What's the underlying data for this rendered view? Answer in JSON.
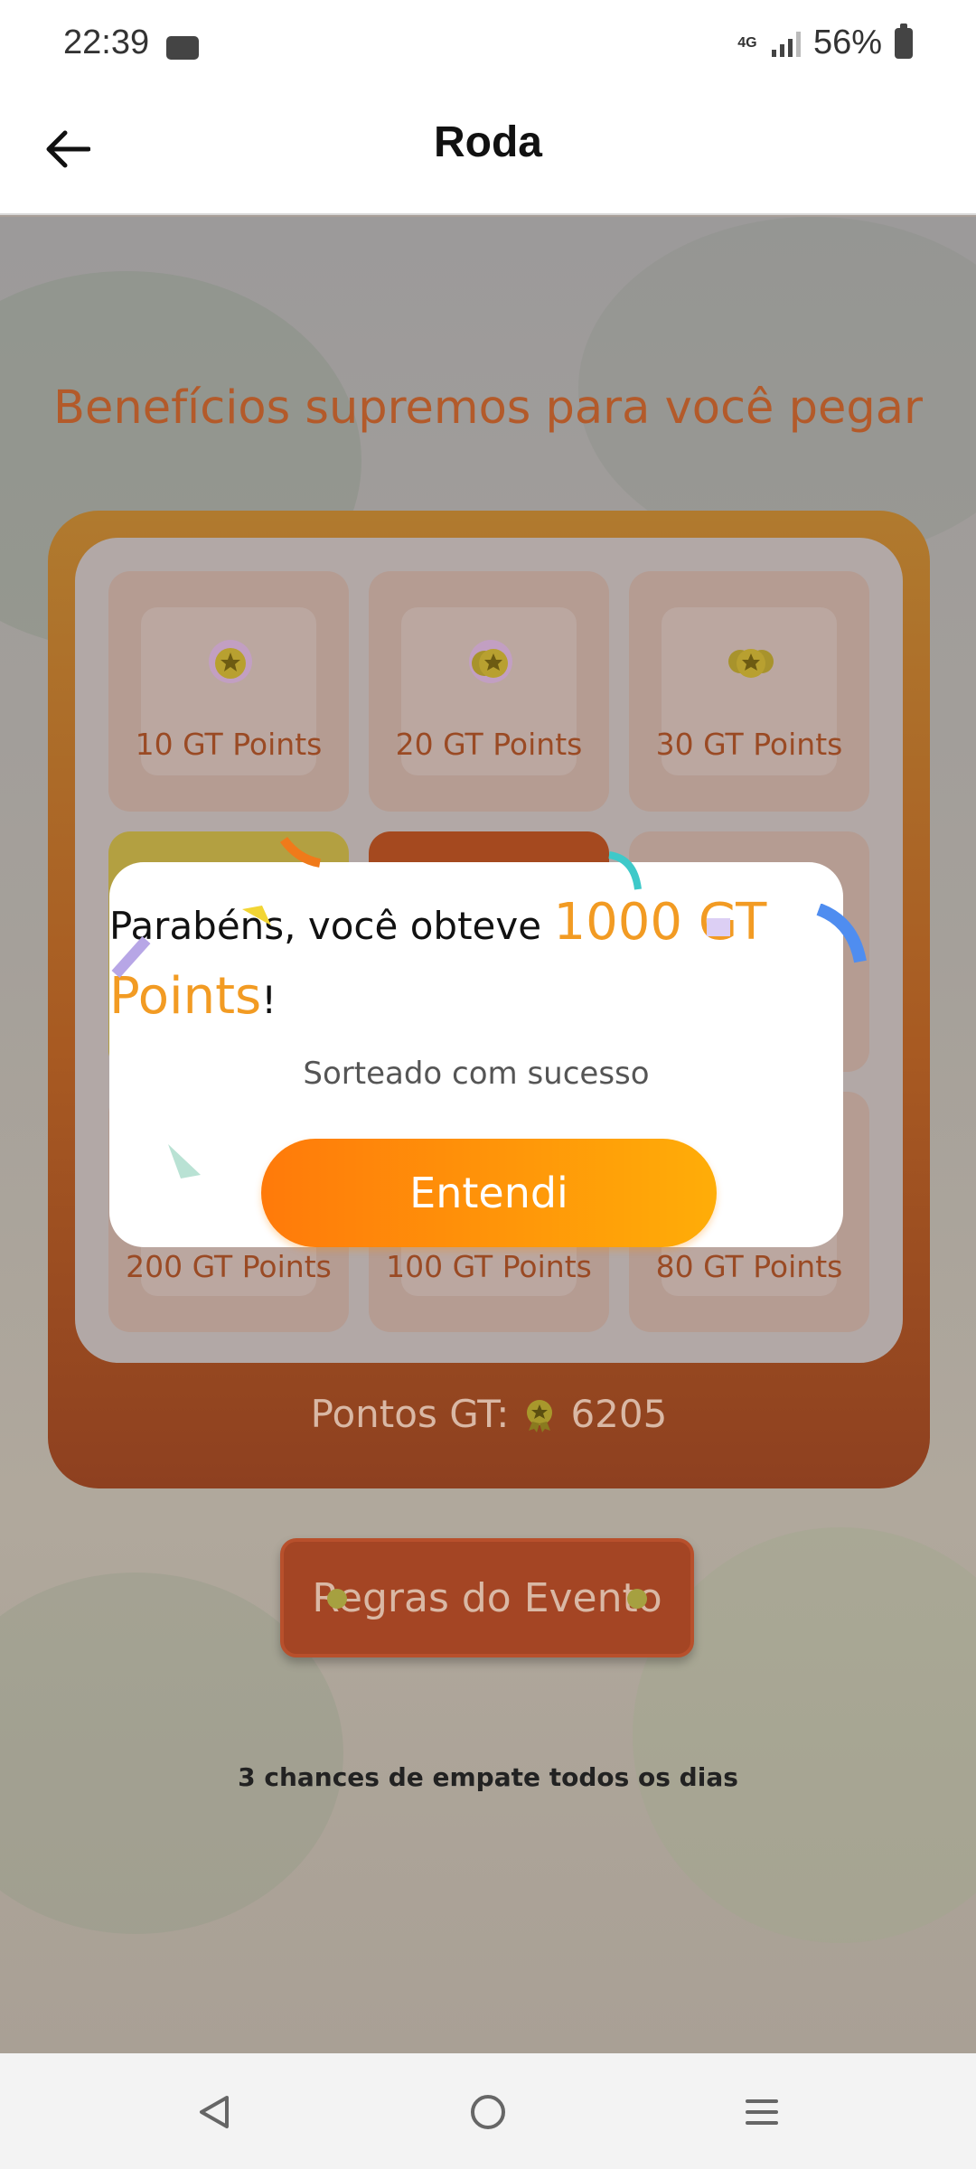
{
  "status_bar": {
    "time": "22:39",
    "network": "4G",
    "battery": "56%",
    "icons": [
      "voicemail-icon",
      "network-4g-icon",
      "signal-icon",
      "battery-icon"
    ]
  },
  "header": {
    "title": "Roda",
    "back_icon": "arrow-left-icon"
  },
  "main": {
    "headline": "Benefícios supremos para você pegar",
    "prizes": [
      {
        "label": "10 GT Points",
        "icon": "gift-medal-icon"
      },
      {
        "label": "20 GT Points",
        "icon": "gift-medal-icon"
      },
      {
        "label": "30 GT Points",
        "icon": "gift-medal-icon"
      },
      {
        "label": "200 GT Points"
      },
      {
        "label": "100 GT Points"
      },
      {
        "label": "80 GT Points"
      }
    ],
    "points_label": "Pontos GT:",
    "points_value": "6205",
    "rules_button": "Regras do Evento",
    "draw_note": "3 chances de empate todos os dias"
  },
  "dialog": {
    "prefix": "Parabéns, você obteve ",
    "highlight": "1000 GT Points",
    "suffix": "!",
    "subtitle": "Sorteado com sucesso",
    "button": "Entendi"
  },
  "nav_bar": {
    "icons": [
      "back-triangle-icon",
      "home-circle-icon",
      "menu-lines-icon"
    ]
  },
  "colors": {
    "accent": "#f29b23",
    "button_start": "#ff7a0a",
    "button_end": "#ffad08",
    "headline": "#b35a2a"
  }
}
